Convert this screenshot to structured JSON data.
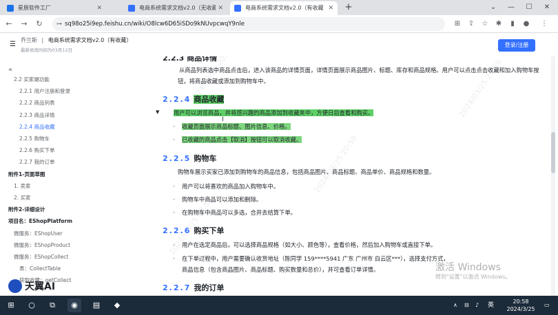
{
  "browser": {
    "tabs": [
      {
        "title": "星辰软件工厂",
        "color": "#1a73e8"
      },
      {
        "title": "电商系统需求文档v2.0（无收藏",
        "color": "#3370ff"
      },
      {
        "title": "电商系统需求文档v2.0（有收藏",
        "color": "#3370ff"
      }
    ],
    "url": "sq98o25i9ep.feishu.cn/wiki/O8lcw6D65iSDo9kNUvpcwqY9nle"
  },
  "doc": {
    "breadcrumb_root": "乔兰斯",
    "breadcrumb_title": "电商系统需求文档v2.0（有收藏）",
    "updated": "最新修改时间为03月12日",
    "login_label": "登录/注册"
  },
  "sidebar": {
    "items": [
      {
        "label": "2.2 买家端功能",
        "indent": 20,
        "style": "normal"
      },
      {
        "label": "2.2.1 用户注册和登录",
        "indent": 28,
        "style": "normal"
      },
      {
        "label": "2.2.2 商品列表",
        "indent": 28,
        "style": "normal"
      },
      {
        "label": "2.2.3 商品详情",
        "indent": 28,
        "style": "normal"
      },
      {
        "label": "2.2.4 商品收藏",
        "indent": 28,
        "style": "active"
      },
      {
        "label": "2.2.5 购物车",
        "indent": 28,
        "style": "normal"
      },
      {
        "label": "2.2.6 购买下单",
        "indent": 28,
        "style": "normal"
      },
      {
        "label": "2.2.7 我的订单",
        "indent": 28,
        "style": "normal"
      },
      {
        "label": "附件1-页面草图",
        "indent": 12,
        "style": "bold"
      },
      {
        "label": "1. 卖家",
        "indent": 20,
        "style": "normal"
      },
      {
        "label": "2. 买家",
        "indent": 20,
        "style": "normal"
      },
      {
        "label": "附件2-详细设计",
        "indent": 12,
        "style": "bold"
      },
      {
        "label": "项目名：EShopPlatform",
        "indent": 12,
        "style": "bold"
      },
      {
        "label": "微服务：EShopUser",
        "indent": 20,
        "style": "normal"
      },
      {
        "label": "微服务：EShopProduct",
        "indent": 20,
        "style": "normal"
      },
      {
        "label": "微服务：EShopCollect",
        "indent": 20,
        "style": "normal"
      },
      {
        "label": "表：CollectTable",
        "indent": 28,
        "style": "normal"
      },
      {
        "label": "获取收藏：getCollect",
        "indent": 28,
        "style": "normal"
      }
    ]
  },
  "content": {
    "s223_heading_partial": "2.2.3 商品详情",
    "s223_para": "从商品列表选中商品点击后，进入该商品的详情页面，详情页面展示商品图片、标题、库存和商品规格。用户可以点击点击收藏和加入购物车按钮，将商品收藏或添加到购物车中。",
    "s224_num": "2.2.4",
    "s224_title": "商品收藏",
    "s224_para": "用户可以浏览商品，并将感兴趣的商品添加到收藏夹中，方便日后查看和购买。",
    "s224_li1": "收藏页面展示商品标题、图片信息、价格。",
    "s224_li2": "已收藏的商品点击【取消】按钮可以取消收藏。",
    "s225_num": "2.2.5",
    "s225_title": "购物车",
    "s225_para": "购物车展示买家已添加到购物车的商品信息，包括商品图片、商品标题、商品单价、商品规格和数量。",
    "s225_li1": "用户可以将喜欢的商品加入购物车中。",
    "s225_li2": "购物车中商品可以添加和删除。",
    "s225_li3": "在购物车中商品可以多选，合并去结算下单。",
    "s226_num": "2.2.6",
    "s226_title": "购买下单",
    "s226_li1": "用户在选定商品后，可以选择商品规格（如大小、颜色等），查看价格，然后加入购物车或直接下单。",
    "s226_li2_line1": "在下单过程中，用户需要确认收货地址（陈同学 159****5941 广东 广州市 白云区***），选择支付方式，",
    "s226_li2_line2": "商品信息（包含商品图片、商品标题、购买数量和总价），并可查看订单详情。",
    "s227_num": "2.2.7",
    "s227_title": "我的订单"
  },
  "overlay": {
    "activate_title": "激活 Windows",
    "activate_sub": "转到\"设置\"以激活 Windows。",
    "logo_text": "天翼AI"
  },
  "taskbar": {
    "ime": "英",
    "time": "20:58",
    "date": "2024/3/25"
  }
}
